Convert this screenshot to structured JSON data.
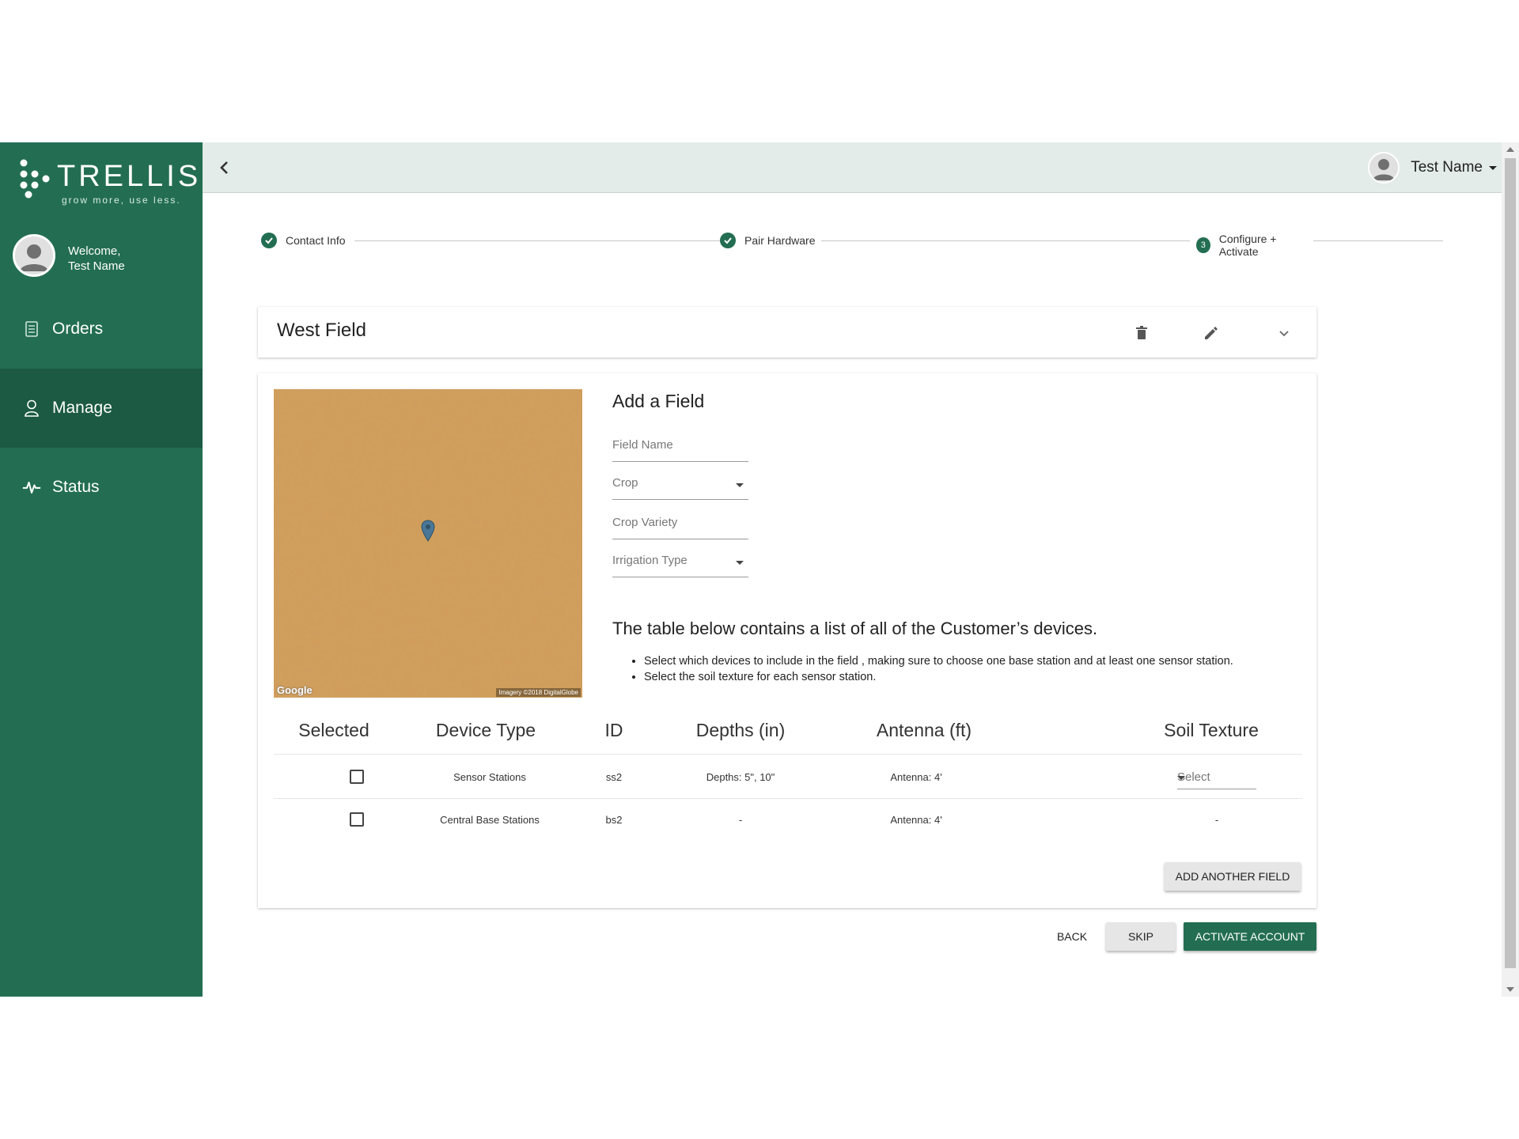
{
  "brand": {
    "name": "TRELLIS",
    "tagline": "grow more, use less."
  },
  "sidebar": {
    "welcome_line1": "Welcome,",
    "welcome_line2": "Test Name",
    "items": [
      {
        "label": "Orders",
        "icon": "document-icon",
        "active": false
      },
      {
        "label": "Manage",
        "icon": "person-icon",
        "active": true
      },
      {
        "label": "Status",
        "icon": "pulse-icon",
        "active": false
      }
    ]
  },
  "topbar": {
    "user_name": "Test Name"
  },
  "stepper": {
    "steps": [
      {
        "label": "Contact Info",
        "state": "complete"
      },
      {
        "label": "Pair Hardware",
        "state": "complete"
      },
      {
        "label": "Configure + Activate",
        "state": "current",
        "number": "3"
      }
    ]
  },
  "field": {
    "title": "West Field"
  },
  "map": {
    "provider": "Google",
    "credit": "Imagery ©2018 DigitalGlobe"
  },
  "form": {
    "title": "Add a Field",
    "field_name_placeholder": "Field Name",
    "crop_label": "Crop",
    "crop_variety_placeholder": "Crop Variety",
    "irrigation_label": "Irrigation Type"
  },
  "devices": {
    "intro": "The table below contains a list of all of the Customer’s devices.",
    "bullets": [
      "Select which devices to include in the field , making sure to choose one base station and at least one sensor station.",
      "Select the soil texture for each sensor station."
    ],
    "headers": [
      "Selected",
      "Device Type",
      "ID",
      "Depths (in)",
      "Antenna (ft)",
      "Soil Texture"
    ],
    "rows": [
      {
        "device_type": "Sensor Stations",
        "id": "ss2",
        "depths": "Depths: 5\", 10\"",
        "antenna": "Antenna: 4'",
        "soil": "Select",
        "selected": false
      },
      {
        "device_type": "Central Base Stations",
        "id": "bs2",
        "depths": "-",
        "antenna": "Antenna: 4'",
        "soil": "-",
        "selected": false
      }
    ]
  },
  "buttons": {
    "add_another_field": "ADD ANOTHER FIELD",
    "back": "BACK",
    "skip": "SKIP",
    "activate": "ACTIVATE ACCOUNT"
  },
  "colors": {
    "brand_green": "#236e52",
    "active_nav": "#1c5a43",
    "topbar": "#e3ece8",
    "map_soil": "#d19d5a"
  }
}
